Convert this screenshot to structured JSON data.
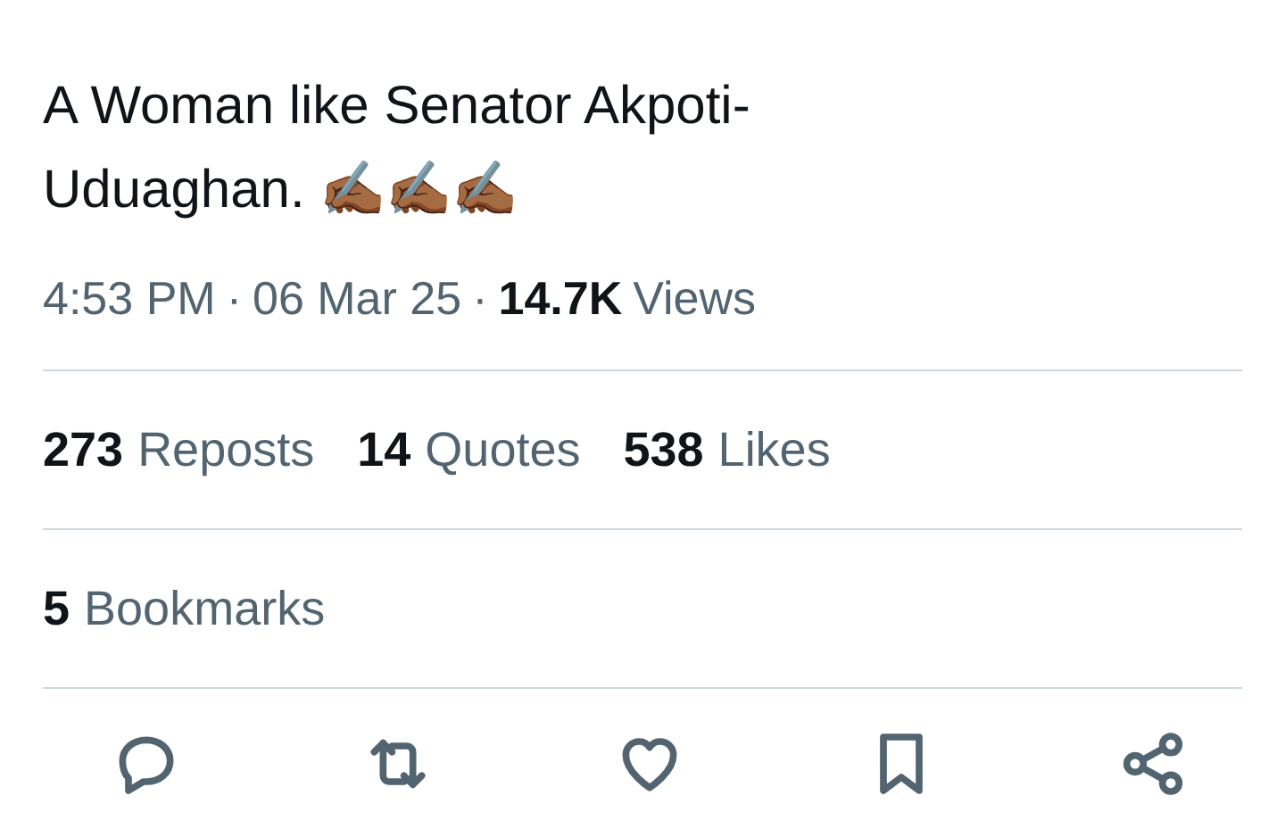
{
  "tweet": {
    "text": "A Woman like Senator Akpoti-Uduaghan. ✍🏾✍🏾✍🏾"
  },
  "meta": {
    "time": "4:53 PM",
    "separator_1": "·",
    "date": "06 Mar 25",
    "separator_2": "·",
    "views_count": "14.7K",
    "views_label": "Views"
  },
  "stats": [
    {
      "count": "273",
      "label": "Reposts"
    },
    {
      "count": "14",
      "label": "Quotes"
    },
    {
      "count": "538",
      "label": "Likes"
    }
  ],
  "bookmarks": {
    "count": "5",
    "label": "Bookmarks"
  }
}
